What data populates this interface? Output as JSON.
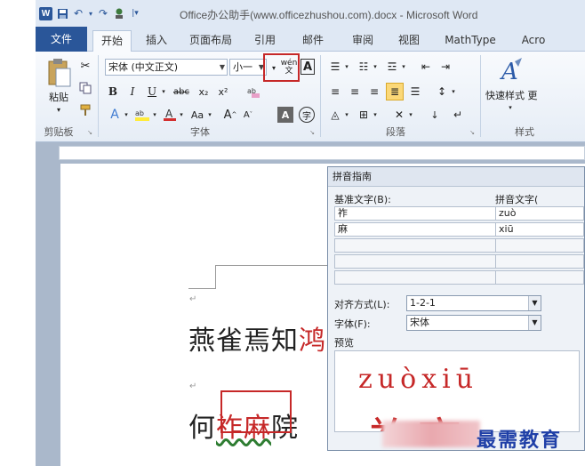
{
  "titlebar": {
    "app_icon": "W",
    "title": "Office办公助手(www.officezhushou.com).docx - Microsoft Word"
  },
  "tabs": [
    "文件",
    "开始",
    "插入",
    "页面布局",
    "引用",
    "邮件",
    "审阅",
    "视图",
    "MathType",
    "Acro"
  ],
  "ribbon": {
    "clipboard": {
      "paste_label": "粘贴",
      "group_label": "剪贴板"
    },
    "font": {
      "font_name": "宋体 (中文正文)",
      "font_size": "小一",
      "phonetic_button_label": "wén 文",
      "char_border_label": "A",
      "bold": "B",
      "italic": "I",
      "underline": "U",
      "strike": "abc",
      "subscript": "x₂",
      "superscript": "x²",
      "grow": "A",
      "shrink": "A",
      "change_case": "Aa",
      "group_label": "字体"
    },
    "paragraph": {
      "group_label": "段落"
    },
    "styles": {
      "quick_styles_label": "快速样式 更",
      "group_label": "样式"
    }
  },
  "document": {
    "line1": {
      "normal": "燕雀焉知",
      "red": "鸿"
    },
    "line2": {
      "before": "何",
      "highlight": "祚麻",
      "after": "院"
    },
    "para_mark": "↵"
  },
  "dialog": {
    "title": "拼音指南",
    "base_text_label": "基准文字(B):",
    "ruby_text_label": "拼音文字(",
    "rows": [
      {
        "base": "祚",
        "ruby": "zuò"
      },
      {
        "base": "麻",
        "ruby": "xiū"
      }
    ],
    "align_label": "对齐方式(L):",
    "align_value": "1-2-1",
    "font_label": "字体(F):",
    "font_value": "宋体",
    "preview_label": "预览",
    "preview_pinyin": "zuòxiū",
    "preview_chars": "祚麻"
  },
  "watermark": {
    "text": "最需教育"
  }
}
